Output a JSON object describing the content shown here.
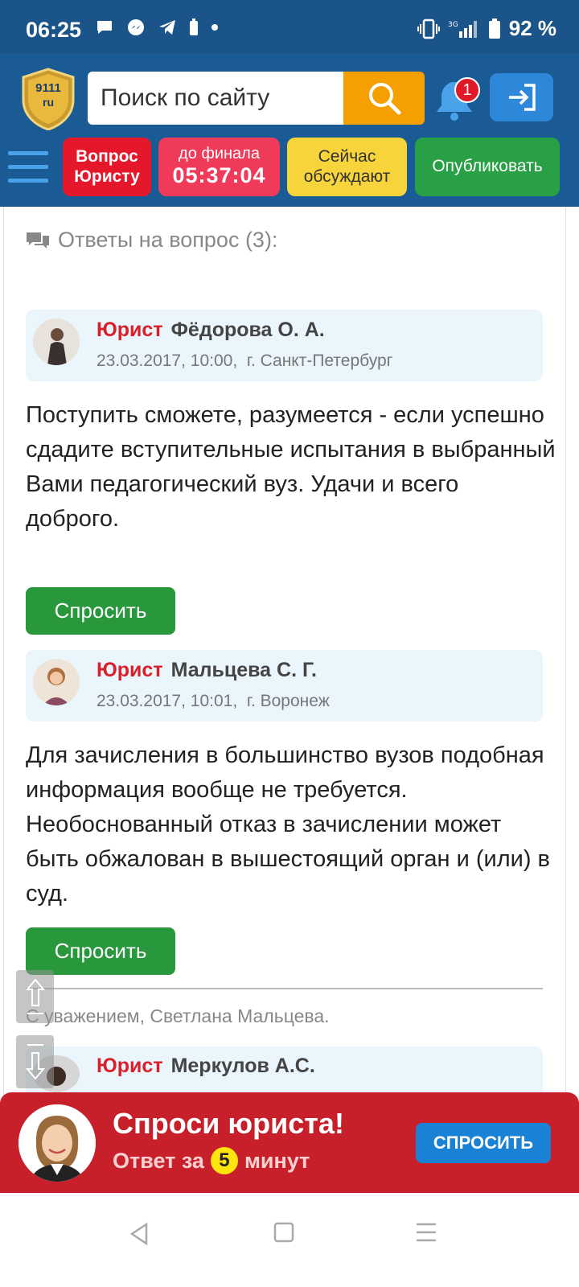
{
  "status_bar": {
    "time": "06:25",
    "battery": "92 %",
    "icons": [
      "chat-bubble-icon",
      "messenger-icon",
      "telegram-icon",
      "battery-small-icon",
      "dot-icon",
      "vibrate-icon",
      "signal-icon",
      "battery-icon"
    ]
  },
  "header": {
    "logo_text_1": "9111",
    "logo_text_2": "ru",
    "search_placeholder": "Поиск по сайту",
    "notification_count": "1",
    "buttons": {
      "ask_line1": "Вопрос",
      "ask_line2": "Юристу",
      "timer_label": "до финала",
      "timer_value": "05:37:04",
      "discuss_line1": "Сейчас",
      "discuss_line2": "обсуждают",
      "publish": "Опубликовать"
    }
  },
  "main": {
    "section_title": "Ответы на вопрос (3):",
    "answers": [
      {
        "role": "Юрист",
        "name": "Фёдорова О. А.",
        "date": "23.03.2017, 10:00,",
        "city": "г. Санкт-Петербург",
        "text": "Поступить сможете, разумеется - если успешно сдадите вступительные испытания в выбранный Вами педагогический вуз. Удачи и всего доброго.",
        "button": "Спросить"
      },
      {
        "role": "Юрист",
        "name": "Мальцева С. Г.",
        "date": "23.03.2017, 10:01,",
        "city": "г. Воронеж",
        "text": "Для зачисления в большинство вузов подобная информация вообще не требуется. Необоснованный отказ в зачислении может быть обжалован в вышестоящий орган и (или) в суд.",
        "button": "Спросить",
        "signature": "С уважением, Светлана Мальцева."
      },
      {
        "role": "Юрист",
        "name": "Меркулов А.С."
      }
    ]
  },
  "banner": {
    "title": "Спроси юриста!",
    "sub_before": "Ответ за",
    "sub_number": "5",
    "sub_after": "минут",
    "button": "СПРОСИТЬ"
  },
  "colors": {
    "header_bg": "#1b5b95",
    "accent_orange": "#f59f00",
    "red": "#e5172a",
    "green": "#29983d",
    "banner_red": "#c7202a"
  }
}
